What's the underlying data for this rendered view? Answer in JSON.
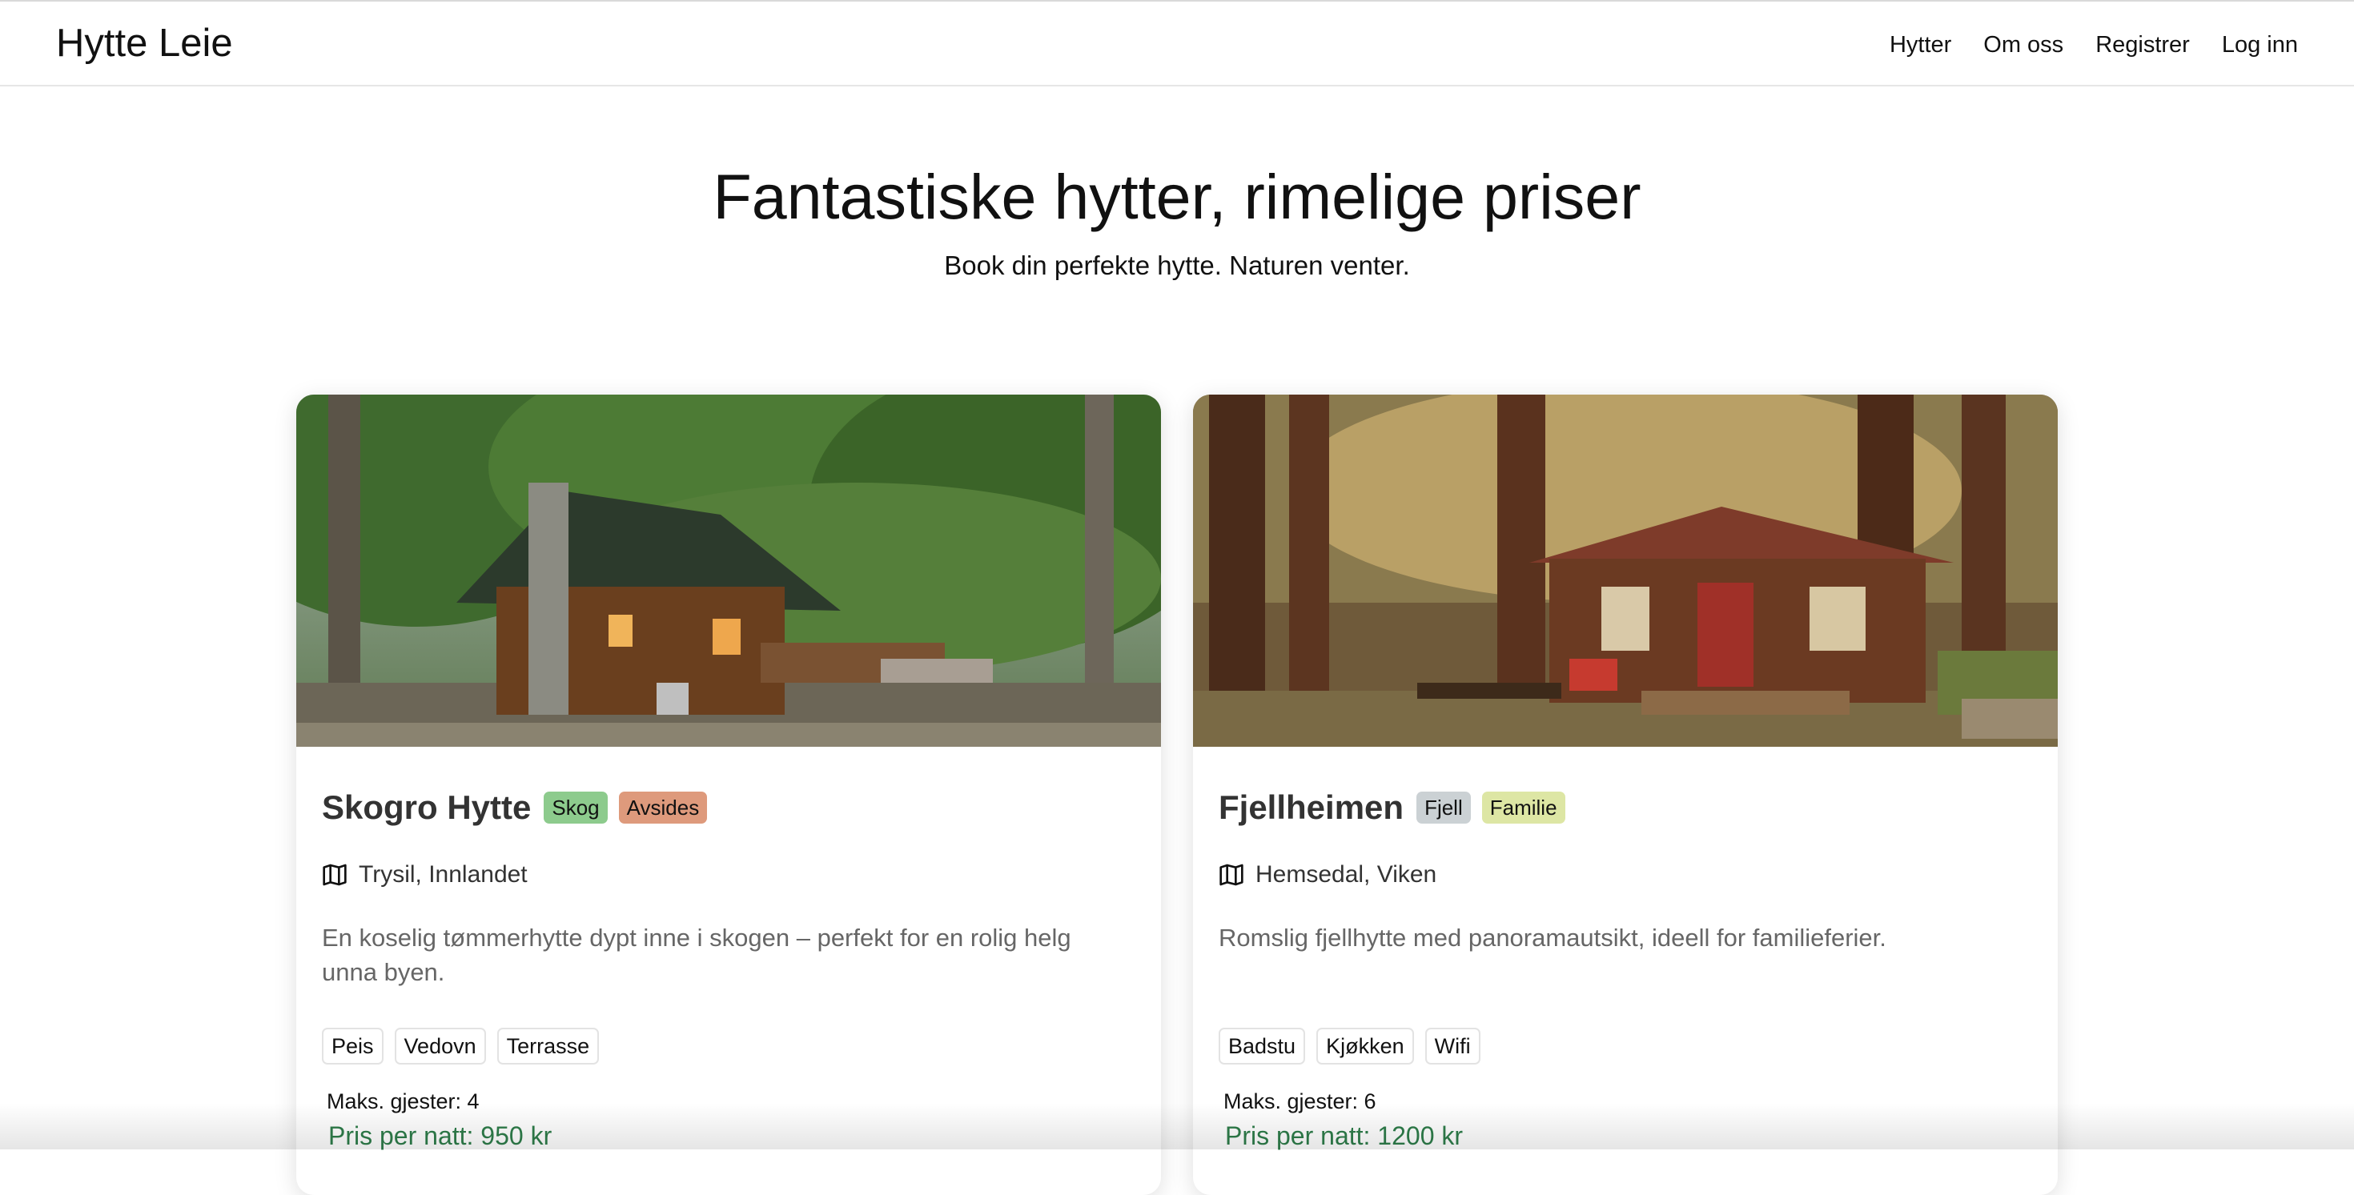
{
  "header": {
    "brand": "Hytte Leie",
    "nav": [
      "Hytter",
      "Om oss",
      "Registrer",
      "Log inn"
    ]
  },
  "hero": {
    "title": "Fantastiske hytter, rimelige priser",
    "subtitle": "Book din perfekte hytte. Naturen venter."
  },
  "colors": {
    "price": "#2e7d4a",
    "tag_skog": "#8dcb8d",
    "tag_avsides": "#de9a7c",
    "tag_fjell": "#cbd1d4",
    "tag_familie": "#dde6a4"
  },
  "cabins": [
    {
      "name": "Skogro Hytte",
      "tags": [
        "Skog",
        "Avsides"
      ],
      "location": "Trysil, Innlandet",
      "location_icon": "map-icon",
      "description": "En koselig tømmerhytte dypt inne i skogen – perfekt for en rolig helg unna byen.",
      "amenities": [
        "Peis",
        "Vedovn",
        "Terrasse"
      ],
      "guests": "Maks. gjester: 4",
      "price": "Pris per natt: 950 kr"
    },
    {
      "name": "Fjellheimen",
      "tags": [
        "Fjell",
        "Familie"
      ],
      "location": "Hemsedal, Viken",
      "location_icon": "map-icon",
      "description": "Romslig fjellhytte med panoramautsikt, ideell for familieferier.",
      "amenities": [
        "Badstu",
        "Kjøkken",
        "Wifi"
      ],
      "guests": "Maks. gjester: 6",
      "price": "Pris per natt: 1200 kr"
    }
  ]
}
